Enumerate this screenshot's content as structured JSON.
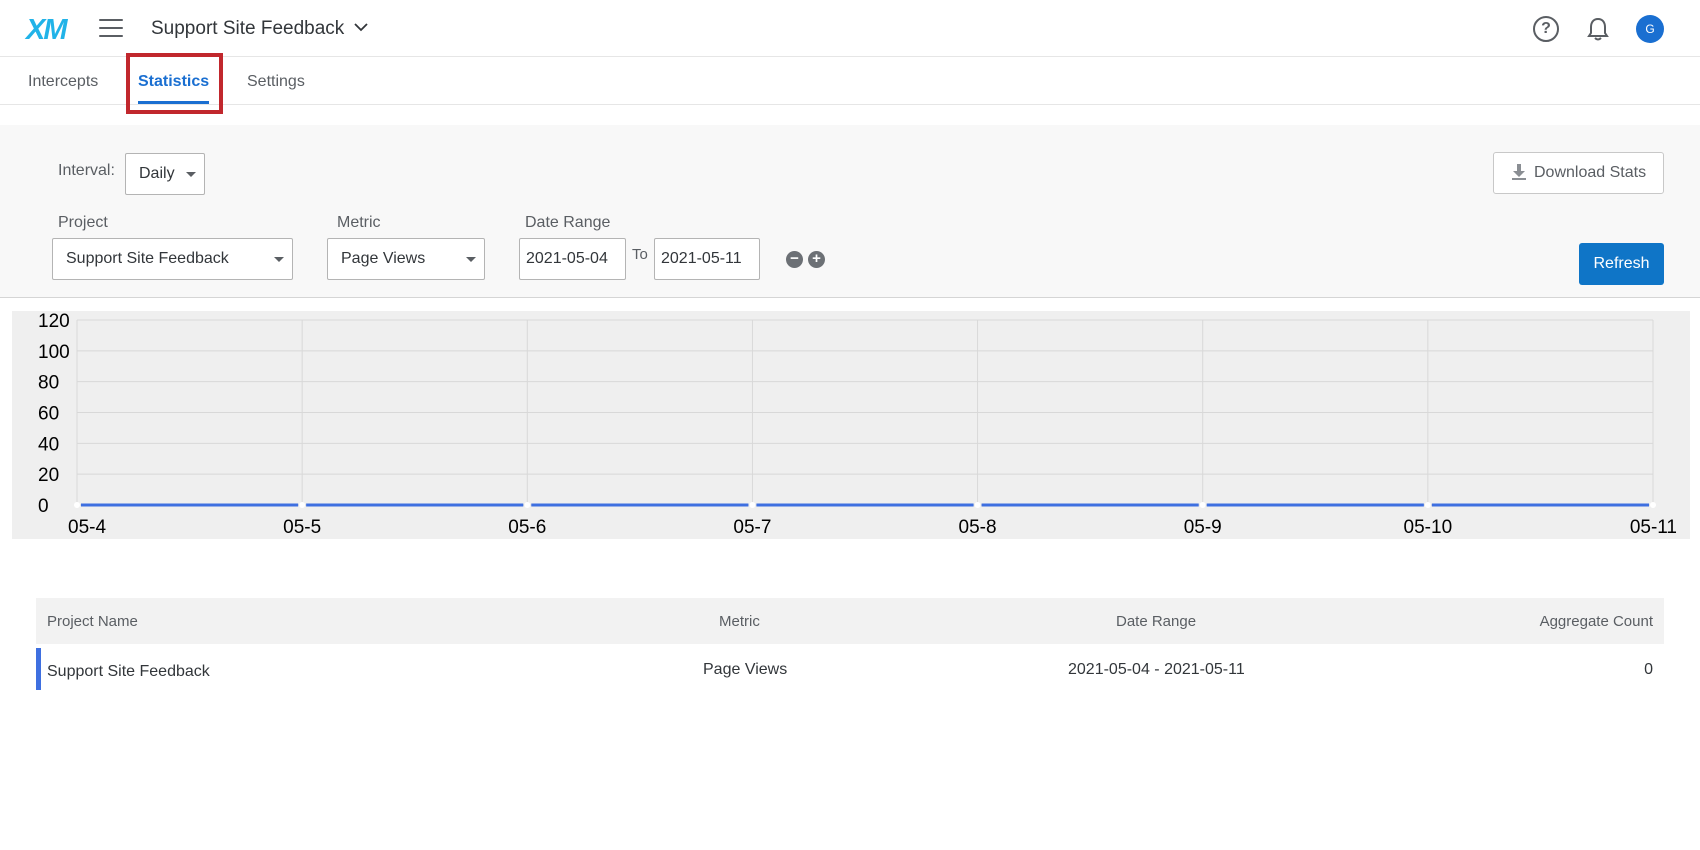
{
  "topbar": {
    "logo": "XM",
    "project_title": "Support Site Feedback",
    "avatar_initial": "G",
    "help_glyph": "?"
  },
  "tabs": [
    {
      "label": "Intercepts",
      "active": false
    },
    {
      "label": "Statistics",
      "active": true
    },
    {
      "label": "Settings",
      "active": false
    }
  ],
  "filters": {
    "interval_label": "Interval:",
    "interval_value": "Daily",
    "project_label": "Project",
    "project_value": "Support Site Feedback",
    "metric_label": "Metric",
    "metric_value": "Page Views",
    "date_range_label": "Date Range",
    "date_from": "2021-05-04",
    "to_label": "To",
    "date_to": "2021-05-11",
    "download_label": "Download Stats",
    "refresh_label": "Refresh"
  },
  "chart_data": {
    "type": "line",
    "x": [
      "05-4",
      "05-5",
      "05-6",
      "05-7",
      "05-8",
      "05-9",
      "05-10",
      "05-11"
    ],
    "series": [
      {
        "values": [
          0,
          0,
          0,
          0,
          0,
          0,
          0,
          0
        ],
        "color": "#3e6fe0"
      }
    ],
    "ylim": [
      0,
      120
    ],
    "yticks": [
      0,
      20,
      40,
      60,
      80,
      100,
      120
    ],
    "grid": true
  },
  "table": {
    "headers": {
      "project_name": "Project Name",
      "metric": "Metric",
      "date_range": "Date Range",
      "aggregate_count": "Aggregate Count"
    },
    "rows": [
      {
        "project_name": "Support Site Feedback",
        "metric": "Page Views",
        "date_range": "2021-05-04 - 2021-05-11",
        "aggregate_count": "0"
      }
    ]
  },
  "colors": {
    "accent": "#1a6fd1",
    "refresh": "#0f75c7",
    "highlight": "#c1272d",
    "series": "#3e6fe0"
  }
}
